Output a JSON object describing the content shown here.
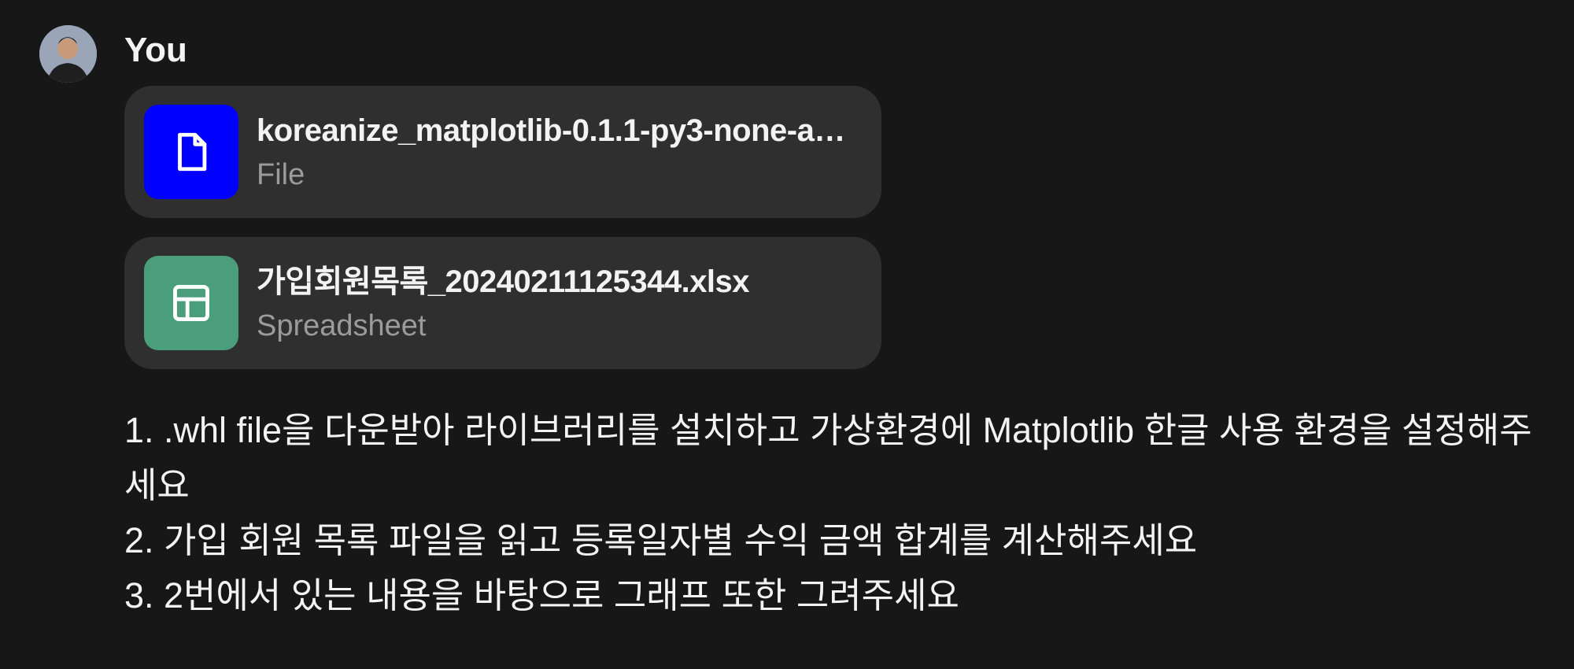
{
  "author": {
    "name": "You",
    "avatar_icon": "user-avatar-photo"
  },
  "attachments": [
    {
      "name": "koreanize_matplotlib-0.1.1-py3-none-an...",
      "type": "File",
      "icon": "document-icon",
      "color": "#0000ff"
    },
    {
      "name": "가입회원목록_20240211125344.xlsx",
      "type": "Spreadsheet",
      "icon": "spreadsheet-icon",
      "color": "#4b9e7c"
    }
  ],
  "message": {
    "lines": [
      "1. .whl file을 다운받아 라이브러리를 설치하고 가상환경에 Matplotlib 한글 사용 환경을 설정해주세요",
      "2. 가입 회원 목록 파일을 읽고 등록일자별 수익 금액 합계를 계산해주세요",
      "3. 2번에서 있는 내용을 바탕으로 그래프 또한 그려주세요"
    ]
  }
}
